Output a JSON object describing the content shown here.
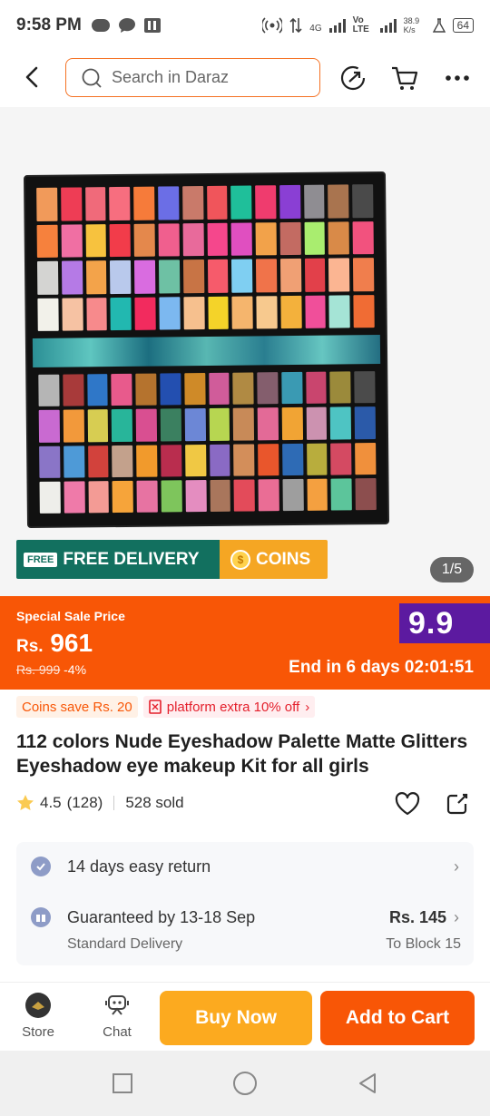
{
  "status_bar": {
    "time": "9:58 PM",
    "net_4g": "4G",
    "volte": "Vo LTE",
    "speed": "38.9 K/s",
    "battery": "64"
  },
  "header": {
    "search_placeholder": "Search in Daraz"
  },
  "gallery": {
    "free_delivery_tag": "FREE",
    "free_delivery": "FREE DELIVERY",
    "coins": "COINS",
    "pager": "1/5",
    "swatch_colors_top": [
      "#f19a5a",
      "#ee3d55",
      "#f06a7a",
      "#f76e7f",
      "#f67b3a",
      "#6b6ee6",
      "#c97a6a",
      "#f0555b",
      "#1fbf9a",
      "#ef3c6e",
      "#8a3fd4",
      "#8f8d92",
      "#a9744f",
      "#4a4a4a",
      "#f6813d",
      "#f06fa3",
      "#f7c23e",
      "#f23c4a",
      "#e4884c",
      "#f05f8e",
      "#e86a9b",
      "#f5478c",
      "#e04fc0",
      "#f2a24a",
      "#c36b62",
      "#a9ed6f",
      "#d98a48",
      "#f2527e",
      "#d4d4d2",
      "#b57ae6",
      "#f3a34a",
      "#b9c9ec",
      "#d96ce0",
      "#6ec1a4",
      "#c87445",
      "#f65b6b",
      "#7fcff2",
      "#f0734a",
      "#f0a074",
      "#e2404a",
      "#fbb592",
      "#f07e4d",
      "#f2f1ea",
      "#f6c2a3",
      "#f78a8c",
      "#22b8b0",
      "#f22b5e",
      "#7cb8f0",
      "#f6c08e",
      "#f4d329",
      "#f5b56d",
      "#f7c98e",
      "#f3b13c",
      "#f04f9a",
      "#a5e4d6",
      "#f06c34"
    ],
    "swatch_colors_bottom": [
      "#b5b5b5",
      "#a83a3a",
      "#2f77c8",
      "#e85a8c",
      "#b5732e",
      "#234fb0",
      "#cf8a28",
      "#d05c9a",
      "#b08a43",
      "#845e6d",
      "#3a9ab3",
      "#c9456e",
      "#9b8a3b",
      "#4b4b4b",
      "#c96ad1",
      "#f2993b",
      "#d7cd52",
      "#28b59a",
      "#d94f91",
      "#3b8060",
      "#6c87d6",
      "#b7d651",
      "#c88a58",
      "#e36a97",
      "#f1a434",
      "#cc92b0",
      "#4ec4c3",
      "#2b5aa9",
      "#8a75c7",
      "#4e9ad7",
      "#d2423c",
      "#c3a18c",
      "#f19a2c",
      "#b92d4e",
      "#f0c844",
      "#8a6ac4",
      "#d38e5a",
      "#e9562c",
      "#2e6bb5",
      "#b8ad3d",
      "#d44a62",
      "#f0903c",
      "#eeeeea",
      "#ef7aa9",
      "#f39b95",
      "#f6a43a",
      "#e773a2",
      "#7ec55c",
      "#e48dc0",
      "#a9765c",
      "#e34b5a",
      "#ea6d95",
      "#9e9e9e",
      "#f4a040",
      "#5cc59b",
      "#8c4e4e"
    ]
  },
  "price": {
    "label": "Special Sale Price",
    "currency": "Rs.",
    "amount": "961",
    "old_price": "Rs. 999",
    "discount": "-4%",
    "countdown": "End in 6 days 02:01:51",
    "badge": "9.9",
    "colors": {
      "banner": "#f85606",
      "badge": "#5c1aa0"
    }
  },
  "promos": {
    "coins_save": "Coins save Rs. 20",
    "platform_extra": "platform extra 10% off",
    "platform_chevron": "›"
  },
  "product": {
    "title": "112 colors Nude Eyeshadow Palette Matte Glitters Eyeshadow eye makeup Kit for all girls",
    "rating": "4.5",
    "reviews": "(128)",
    "sold": "528 sold"
  },
  "services": {
    "return_text": "14 days easy return",
    "guarantee": "Guaranteed by 13-18 Sep",
    "delivery_type": "Standard Delivery",
    "delivery_price": "Rs. 145",
    "location": "To Block 15",
    "chevron": "›"
  },
  "bottom_bar": {
    "store": "Store",
    "chat": "Chat",
    "buy_now": "Buy Now",
    "add_to_cart": "Add to Cart"
  }
}
